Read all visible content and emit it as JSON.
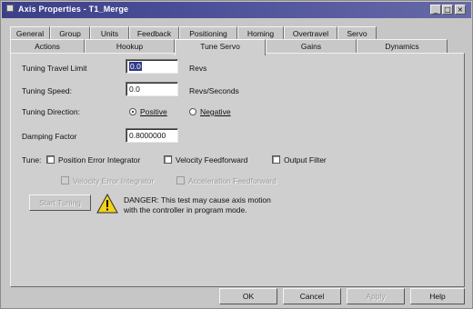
{
  "window": {
    "title": "Axis Properties - T1_Merge",
    "controls": {
      "min": "_",
      "max": "□",
      "close": "×"
    }
  },
  "tabs": {
    "row1": [
      "General",
      "Group",
      "Units",
      "Feedback",
      "Positioning",
      "Homing",
      "Overtravel",
      "Servo"
    ],
    "row2": [
      "Actions",
      "Hookup",
      "Tune Servo",
      "Gains",
      "Dynamics"
    ],
    "active": "Tune Servo"
  },
  "tune_servo": {
    "travel_limit_label": "Tuning Travel Limit",
    "travel_limit_value": "0.0",
    "travel_limit_unit": "Revs",
    "speed_label": "Tuning Speed:",
    "speed_value": "0.0",
    "speed_unit": "Revs/Seconds",
    "direction_label": "Tuning Direction:",
    "direction_positive": "Positive",
    "direction_negative": "Negative",
    "direction_selected": "Positive",
    "damping_label": "Damping Factor",
    "damping_value": "0.8000000",
    "tune_label": "Tune:",
    "tune_options": [
      {
        "label": "Position Error Integrator",
        "checked": false,
        "enabled": true
      },
      {
        "label": "Velocity Feedforward",
        "checked": false,
        "enabled": true
      },
      {
        "label": "Output Filter",
        "checked": false,
        "enabled": true
      },
      {
        "label": "Velocity Error Integrator",
        "checked": false,
        "enabled": false
      },
      {
        "label": "Acceleration Feedforward",
        "checked": false,
        "enabled": false
      }
    ],
    "start_button": "Start Tuning",
    "danger_text_line1": "DANGER: This test may cause axis motion",
    "danger_text_line2": "with the controller in program mode."
  },
  "footer": {
    "ok": "OK",
    "cancel": "Cancel",
    "apply": "Apply",
    "help": "Help"
  },
  "colors": {
    "titlebar": "#3c3f86",
    "selection": "#2f3a88",
    "warning_yellow": "#f3d21a"
  },
  "icons": {
    "warning": "warning-triangle-icon"
  }
}
